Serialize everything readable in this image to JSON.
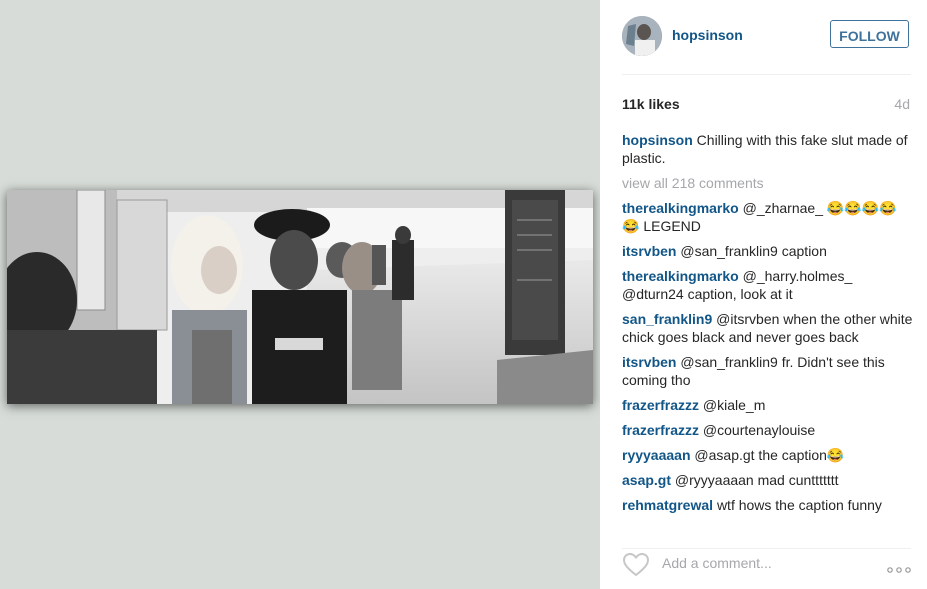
{
  "post": {
    "username": "hopsinson",
    "follow_label": "FOLLOW",
    "likes": "11k likes",
    "age": "4d",
    "caption": "Chilling with this fake slut made of plastic.",
    "view_all": "view all 218 comments",
    "add_comment_placeholder": "Add a comment..."
  },
  "comments": [
    {
      "user": "therealkingmarko",
      "text": "@_zharnae_ 😂😂😂😂😂 LEGEND"
    },
    {
      "user": "itsrvben",
      "text": "@san_franklin9 caption"
    },
    {
      "user": "therealkingmarko",
      "text": "@_harry.holmes_ @dturn24 caption, look at it"
    },
    {
      "user": "san_franklin9",
      "text": "@itsrvben when the other white chick goes black and never goes back"
    },
    {
      "user": "itsrvben",
      "text": "@san_franklin9 fr. Didn't see this coming tho"
    },
    {
      "user": "frazerfrazzz",
      "text": "@kiale_m"
    },
    {
      "user": "frazerfrazzz",
      "text": "@courtenaylouise"
    },
    {
      "user": "ryyyaaaan",
      "text": "@asap.gt the caption😂"
    },
    {
      "user": "asap.gt",
      "text": "@ryyyaaaan mad cunttttttt"
    },
    {
      "user": "rehmatgrewal",
      "text": " wtf hows the caption funny"
    }
  ],
  "icons": {
    "heart": "heart-icon",
    "more": "more-options-icon"
  },
  "colors": {
    "username_blue": "#125688",
    "follow_border": "#3f729b",
    "muted": "#a5a7aa",
    "media_background": "#d7dcd8"
  }
}
